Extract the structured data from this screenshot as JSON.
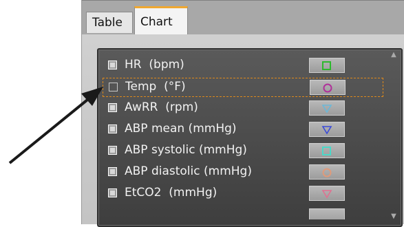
{
  "tabs": [
    {
      "label": "Table",
      "active": false
    },
    {
      "label": "Chart",
      "active": true
    }
  ],
  "parameters": [
    {
      "label": "HR  (bpm)",
      "checked": true,
      "marker": "square-icon",
      "marker_color": "#2db82d"
    },
    {
      "label": "Temp  (°F)",
      "checked": false,
      "marker": "circle-icon",
      "marker_color": "#b0309a",
      "focused": true
    },
    {
      "label": "AwRR  (rpm)",
      "checked": true,
      "marker": "triangle-down-icon",
      "marker_color": "#6ab8d8"
    },
    {
      "label": "ABP mean (mmHg)",
      "checked": true,
      "marker": "triangle-down-icon",
      "marker_color": "#3a4ad8"
    },
    {
      "label": "ABP systolic (mmHg)",
      "checked": true,
      "marker": "square-icon",
      "marker_color": "#4ad8c8"
    },
    {
      "label": "ABP diastolic (mmHg)",
      "checked": true,
      "marker": "circle-icon",
      "marker_color": "#e09a7a"
    },
    {
      "label": "EtCO2  (mmHg)",
      "checked": true,
      "marker": "triangle-down-icon",
      "marker_color": "#e07090"
    }
  ],
  "scrollbar": {
    "up_icon": "triangle-up-icon",
    "down_icon": "triangle-down-icon"
  }
}
